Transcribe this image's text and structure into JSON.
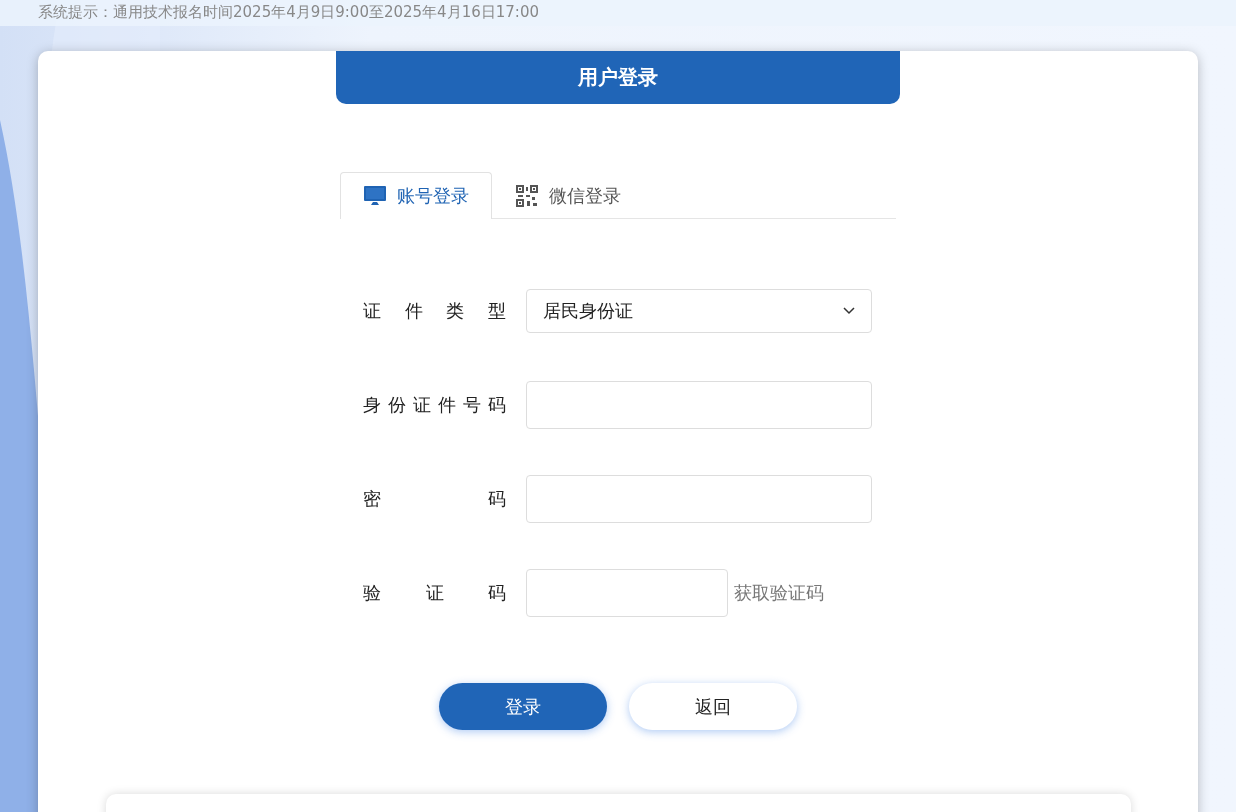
{
  "notice": "系统提示：通用技术报名时间2025年4月9日9:00至2025年4月16日17:00",
  "header": {
    "title": "用户登录"
  },
  "tabs": [
    {
      "label": "账号登录",
      "kind": "monitor",
      "selected": true
    },
    {
      "label": "微信登录",
      "kind": "qrcode",
      "selected": false
    }
  ],
  "form": [
    {
      "kind": "select",
      "label": "证件类型",
      "value": "居民身份证"
    },
    {
      "kind": "text",
      "label": "身份证件号码"
    },
    {
      "kind": "password",
      "label": "密码"
    },
    {
      "kind": "code",
      "label": "验证码",
      "link": "获取验证码"
    }
  ],
  "buttons": [
    {
      "label": "登录",
      "primary": true
    },
    {
      "label": "返回",
      "primary": false
    }
  ]
}
